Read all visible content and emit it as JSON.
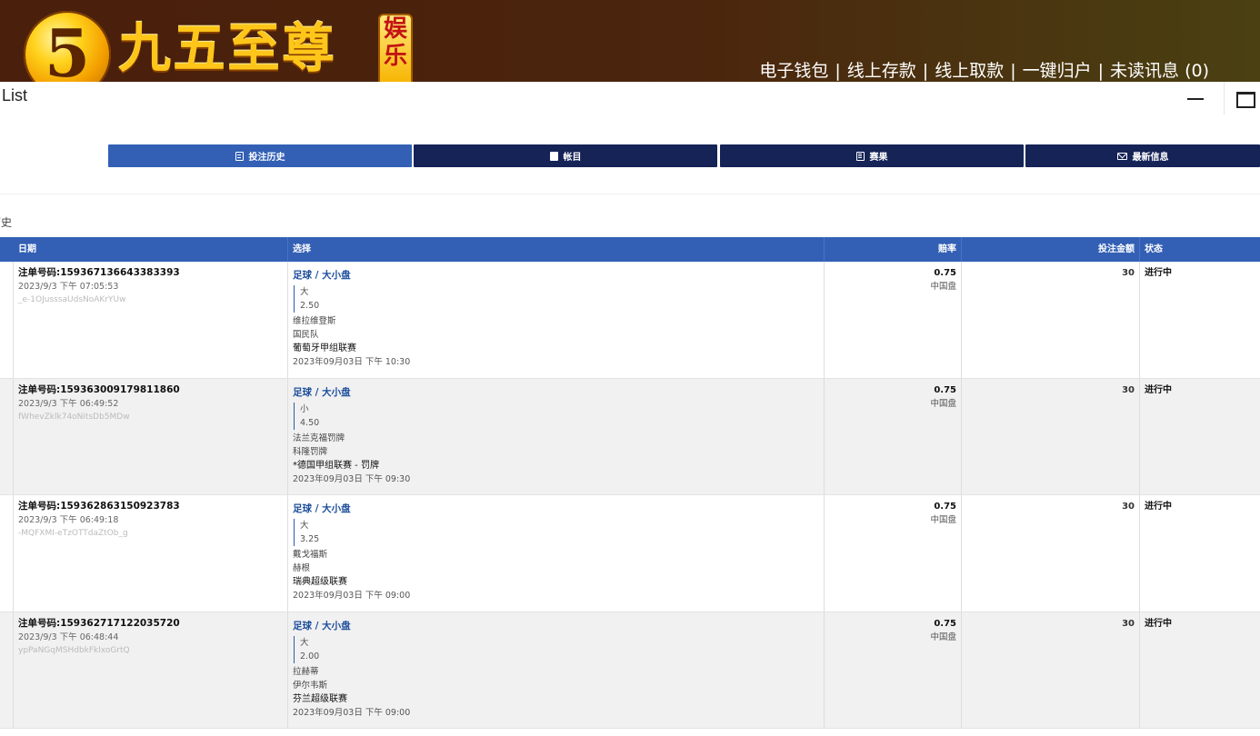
{
  "header": {
    "logo_numeral": "5",
    "brand_name": "九五至尊",
    "brand_badge": "娱乐",
    "nav": [
      "电子钱包",
      "线上存款",
      "线上取款",
      "一键归户",
      "未读讯息 (0)"
    ]
  },
  "window": {
    "title": "List"
  },
  "tabs": [
    {
      "label": "投注历史",
      "active": true,
      "icon": "document-icon"
    },
    {
      "label": "帐目",
      "active": false,
      "icon": "ledger-icon"
    },
    {
      "label": "赛果",
      "active": false,
      "icon": "results-icon"
    },
    {
      "label": "最新信息",
      "active": false,
      "icon": "envelope-icon"
    }
  ],
  "section": {
    "label": "历史"
  },
  "table": {
    "columns": {
      "date": "日期",
      "selection": "选择",
      "odds": "赔率",
      "stake": "投注金额",
      "status": "状态"
    },
    "rows": [
      {
        "bet_no": "注单号码:159367136643383393",
        "time": "2023/9/3 下午 07:05:53",
        "hash": "_e-1OJusssaUdsNoAKrYUw",
        "market": "足球 / 大小盘",
        "pick": "大",
        "line": "2.50",
        "home": "维拉维登斯",
        "away": "国民队",
        "league": "葡萄牙甲组联赛",
        "kickoff": "2023年09月03日 下午 10:30",
        "odds": "0.75",
        "odds_type": "中国盘",
        "stake": "30",
        "status": "进行中"
      },
      {
        "bet_no": "注单号码:159363009179811860",
        "time": "2023/9/3 下午 06:49:52",
        "hash": "fWhevZklk74oNitsDb5MDw",
        "market": "足球 / 大小盘",
        "pick": "小",
        "line": "4.50",
        "home": "法兰克福罚牌",
        "away": "科隆罚牌",
        "league": "*德国甲组联赛 - 罚牌",
        "kickoff": "2023年09月03日 下午 09:30",
        "odds": "0.75",
        "odds_type": "中国盘",
        "stake": "30",
        "status": "进行中"
      },
      {
        "bet_no": "注单号码:159362863150923783",
        "time": "2023/9/3 下午 06:49:18",
        "hash": "-MQFXMI-eTzOTTdaZtOb_g",
        "market": "足球 / 大小盘",
        "pick": "大",
        "line": "3.25",
        "home": "戴戈福斯",
        "away": "赫根",
        "league": "瑞典超级联赛",
        "kickoff": "2023年09月03日 下午 09:00",
        "odds": "0.75",
        "odds_type": "中国盘",
        "stake": "30",
        "status": "进行中"
      },
      {
        "bet_no": "注单号码:159362717122035720",
        "time": "2023/9/3 下午 06:48:44",
        "hash": "ypPaNGqMSHdbkFklxoGrtQ",
        "market": "足球 / 大小盘",
        "pick": "大",
        "line": "2.00",
        "home": "拉赫蒂",
        "away": "伊尔韦斯",
        "league": "芬兰超级联赛",
        "kickoff": "2023年09月03日 下午 09:00",
        "odds": "0.75",
        "odds_type": "中国盘",
        "stake": "30",
        "status": "进行中"
      }
    ]
  },
  "colors": {
    "tab_active": "#3360b5",
    "tab_inactive": "#152357",
    "table_header": "#3360b5",
    "market_text": "#1d4e9b",
    "row_alt": "#f1f1f1"
  }
}
